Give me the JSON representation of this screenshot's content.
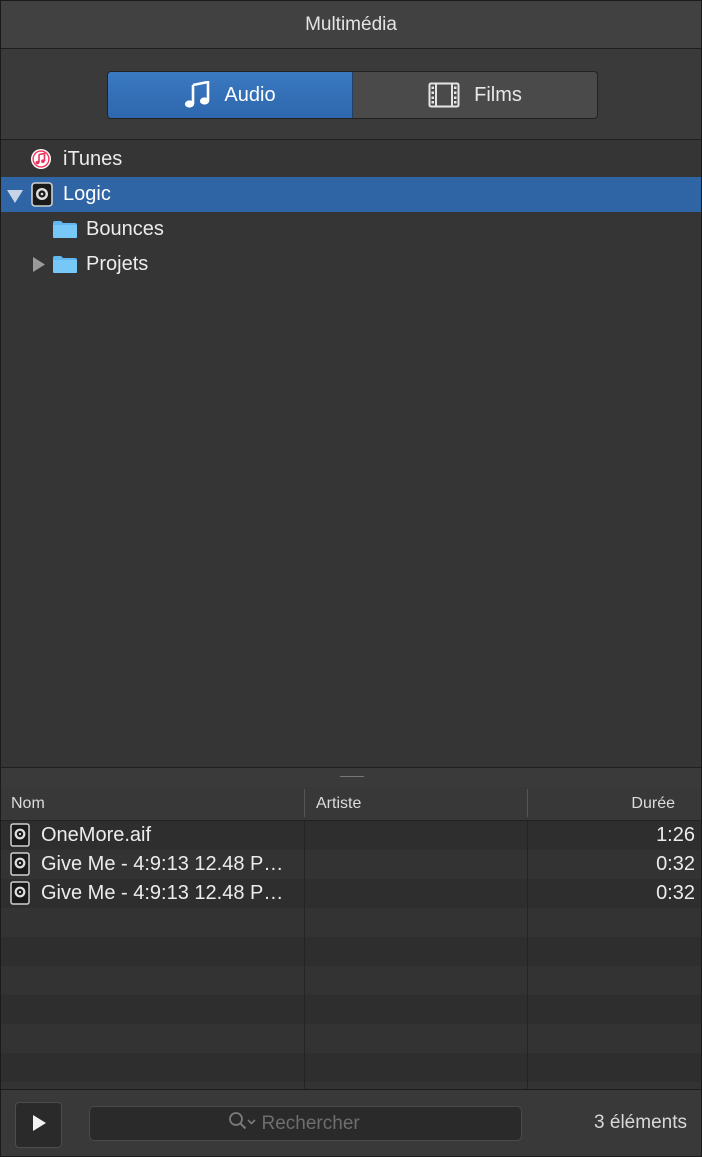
{
  "window": {
    "title": "Multimédia"
  },
  "tabs": [
    {
      "label": "Audio",
      "icon": "music-note-icon",
      "active": true
    },
    {
      "label": "Films",
      "icon": "film-strip-icon",
      "active": false
    }
  ],
  "tree": {
    "items": [
      {
        "label": "iTunes",
        "icon": "itunes-icon",
        "selected": false
      },
      {
        "label": "Logic",
        "icon": "logic-icon",
        "selected": true,
        "expanded": true
      },
      {
        "label": "Bounces",
        "icon": "folder-icon",
        "selected": false
      },
      {
        "label": "Projets",
        "icon": "folder-icon",
        "selected": false,
        "expanded": false
      }
    ]
  },
  "list": {
    "columns": {
      "name": "Nom",
      "artist": "Artiste",
      "duration": "Durée"
    },
    "rows": [
      {
        "name": "OneMore.aif",
        "artist": "",
        "duration": "1:26",
        "icon": "audio-file-icon"
      },
      {
        "name": "Give Me - 4:9:13 12.48 P…",
        "artist": "",
        "duration": "0:32",
        "icon": "audio-file-icon"
      },
      {
        "name": "Give Me - 4:9:13 12.48 P…",
        "artist": "",
        "duration": "0:32",
        "icon": "audio-file-icon"
      }
    ]
  },
  "footer": {
    "search_placeholder": "Rechercher",
    "count_label": "3 éléments"
  },
  "colors": {
    "selection": "#2f65a5",
    "accent": "#3a79c1",
    "folder": "#5fb8f0"
  }
}
